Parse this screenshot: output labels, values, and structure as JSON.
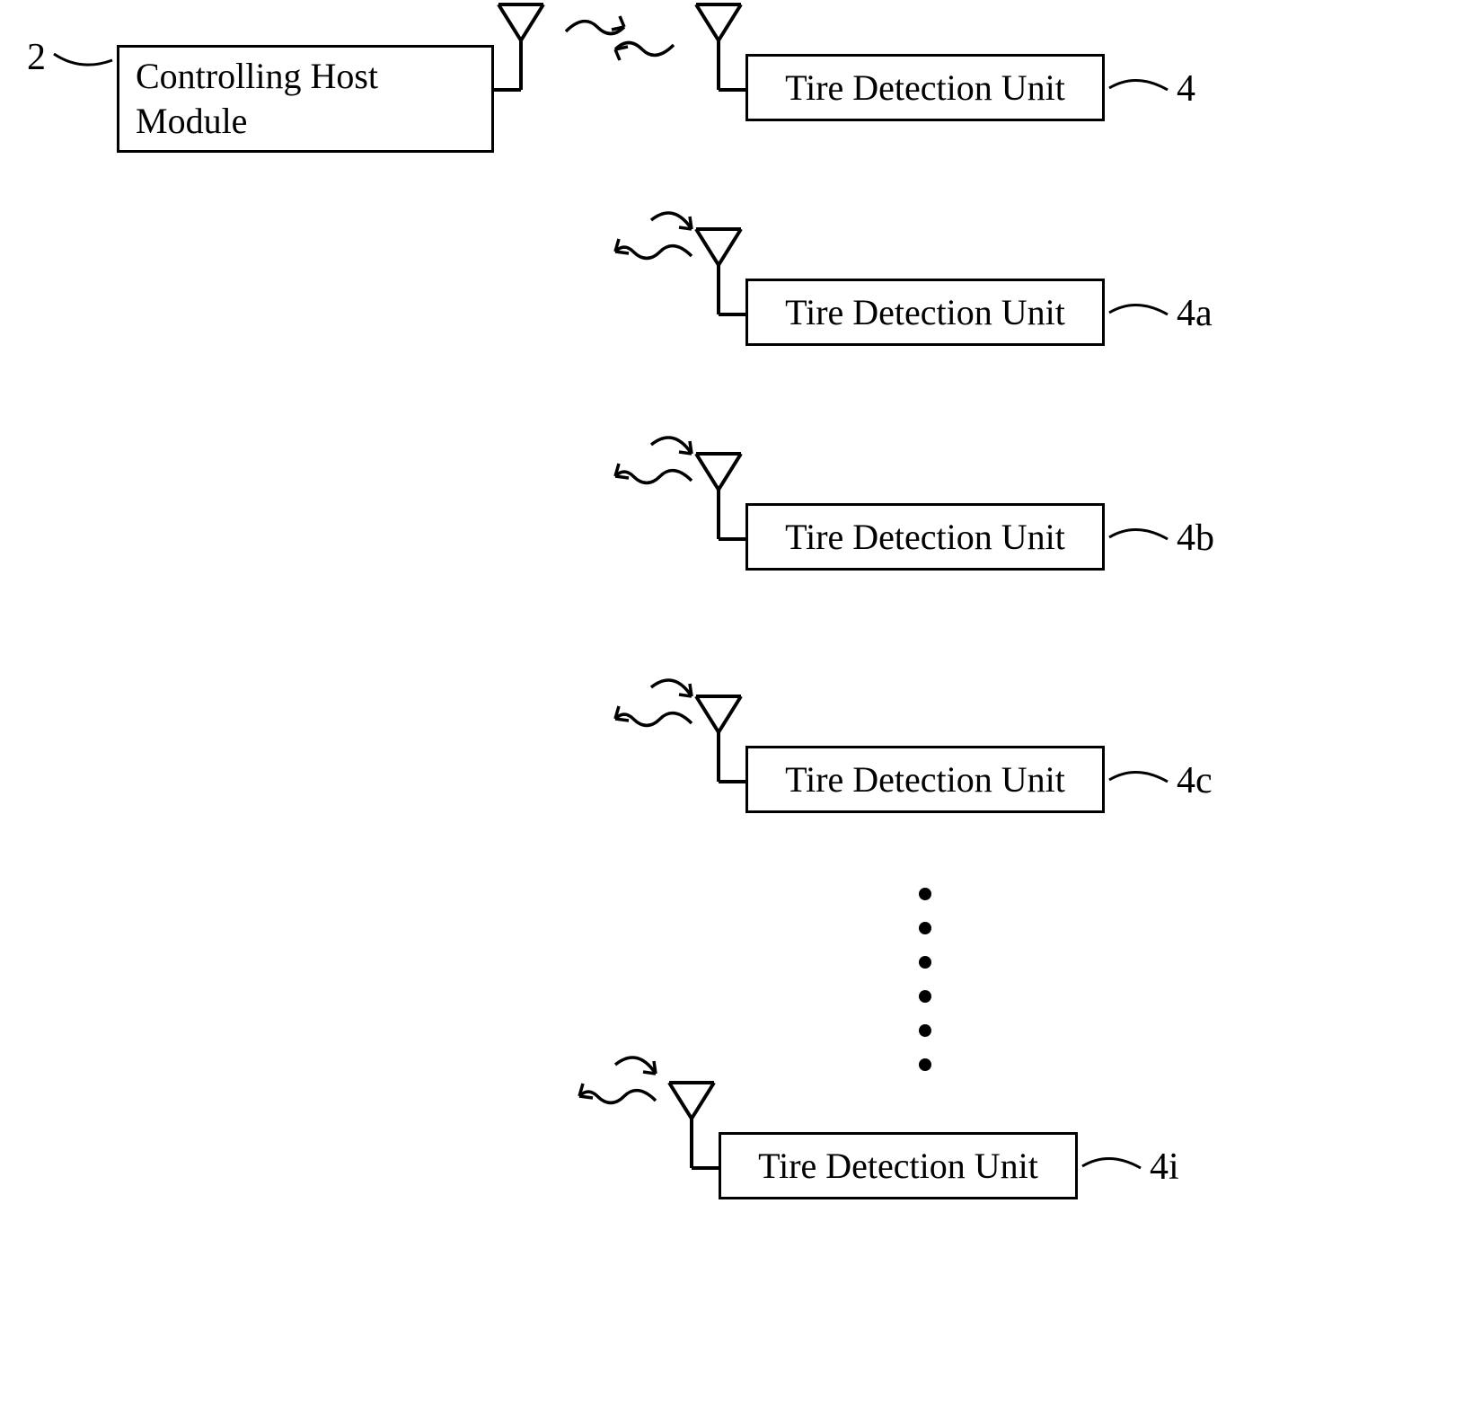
{
  "host": {
    "label": "Controlling Host\nModule",
    "ref": "2"
  },
  "detectionUnits": [
    {
      "label": "Tire Detection Unit",
      "ref": "4"
    },
    {
      "label": "Tire Detection Unit",
      "ref": "4a"
    },
    {
      "label": "Tire Detection Unit",
      "ref": "4b"
    },
    {
      "label": "Tire Detection Unit",
      "ref": "4c"
    },
    {
      "label": "Tire Detection Unit",
      "ref": "4i"
    }
  ]
}
